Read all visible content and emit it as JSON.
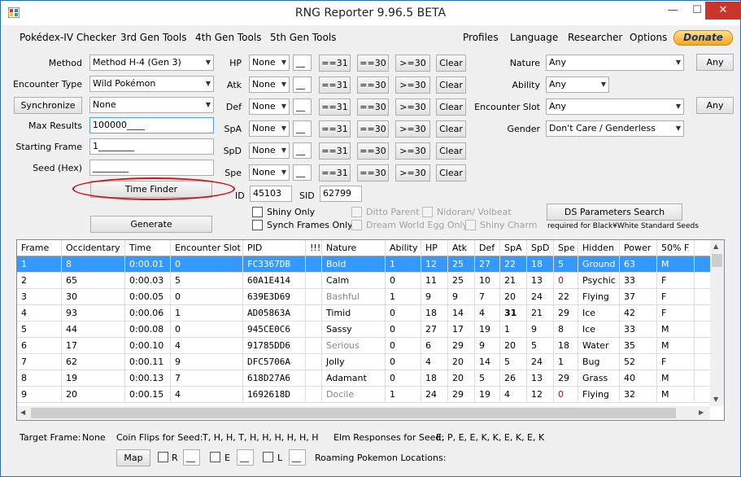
{
  "window": {
    "title": "RNG Reporter 9.96.5 BETA",
    "min": "—",
    "max": "☐",
    "close": "✕"
  },
  "menu": {
    "left": [
      "Pokédex-IV Checker",
      "3rd Gen Tools",
      "4th Gen Tools",
      "5th Gen Tools"
    ],
    "right": [
      "Profiles",
      "Language",
      "Researcher",
      "Options"
    ],
    "donate": "Donate"
  },
  "form": {
    "method_label": "Method",
    "method_value": "Method H-4 (Gen 3)",
    "encounter_label": "Encounter Type",
    "encounter_value": "Wild Pokémon",
    "sync_button": "Synchronize",
    "sync_value": "None",
    "max_label": "Max Results",
    "max_value": "100000____",
    "start_label": "Starting Frame",
    "start_value": "1________",
    "seed_label": "Seed (Hex)",
    "seed_value": "________",
    "time_finder": "Time Finder",
    "generate": "Generate"
  },
  "stats": {
    "rows": [
      {
        "label": "HP"
      },
      {
        "label": "Atk"
      },
      {
        "label": "Def"
      },
      {
        "label": "SpA"
      },
      {
        "label": "SpD"
      },
      {
        "label": "Spe"
      }
    ],
    "combo_value": "None",
    "box_value": "__",
    "b31": "==31",
    "b30": "==30",
    "bge30": ">=30",
    "clear": "Clear"
  },
  "ids": {
    "id_label": "ID",
    "id_value": "45103",
    "sid_label": "SID",
    "sid_value": "62799"
  },
  "checks": {
    "shiny": "Shiny Only",
    "synch": "Synch Frames Only",
    "ditto": "Ditto Parent",
    "nidoran": "Nidoran/ Volbeat",
    "dream": "Dream World Egg Only",
    "charm": "Shiny Charm"
  },
  "right": {
    "nature_label": "Nature",
    "nature_value": "Any",
    "ability_label": "Ability",
    "ability_value": "Any",
    "slot_label": "Encounter Slot",
    "slot_value": "Any",
    "gender_label": "Gender",
    "gender_value": "Don't Care /  Genderless",
    "any_button": "Any",
    "ds_button": "DS Parameters Search",
    "ds_note": "required for Black¥White Standard Seeds"
  },
  "table": {
    "headers": [
      "Frame",
      "Occidentary",
      "Time",
      "Encounter Slot",
      "PID",
      "!!!",
      "Nature",
      "Ability",
      "HP",
      "Atk",
      "Def",
      "SpA",
      "SpD",
      "Spe",
      "Hidden",
      "Power",
      "50% F"
    ],
    "rows": [
      [
        "1",
        "8",
        "0:00.01",
        "0",
        "FC3367DB",
        "",
        "Bold",
        "1",
        "12",
        "25",
        "27",
        "22",
        "18",
        "5",
        "Ground",
        "63",
        "M"
      ],
      [
        "2",
        "65",
        "0:00.03",
        "5",
        "60A1E414",
        "",
        "Calm",
        "0",
        "11",
        "25",
        "10",
        "21",
        "13",
        "0",
        "Psychic",
        "33",
        "F"
      ],
      [
        "3",
        "30",
        "0:00.05",
        "0",
        "639E3D69",
        "",
        "Bashful",
        "1",
        "9",
        "9",
        "7",
        "20",
        "24",
        "22",
        "Flying",
        "37",
        "F"
      ],
      [
        "4",
        "93",
        "0:00.06",
        "1",
        "AD05863A",
        "",
        "Timid",
        "0",
        "18",
        "14",
        "4",
        "31",
        "21",
        "29",
        "Ice",
        "42",
        "F"
      ],
      [
        "5",
        "44",
        "0:00.08",
        "0",
        "945CE0C6",
        "",
        "Sassy",
        "0",
        "27",
        "17",
        "19",
        "1",
        "9",
        "8",
        "Ice",
        "33",
        "M"
      ],
      [
        "6",
        "17",
        "0:00.10",
        "4",
        "91785DD6",
        "",
        "Serious",
        "0",
        "6",
        "29",
        "9",
        "20",
        "5",
        "18",
        "Water",
        "35",
        "M"
      ],
      [
        "7",
        "62",
        "0:00.11",
        "9",
        "DFC5706A",
        "",
        "Jolly",
        "0",
        "4",
        "20",
        "14",
        "5",
        "24",
        "1",
        "Bug",
        "52",
        "F"
      ],
      [
        "8",
        "19",
        "0:00.13",
        "7",
        "618D27A6",
        "",
        "Adamant",
        "0",
        "18",
        "20",
        "5",
        "26",
        "13",
        "29",
        "Grass",
        "40",
        "M"
      ],
      [
        "9",
        "20",
        "0:00.15",
        "4",
        "1692618D",
        "",
        "Docile",
        "1",
        "24",
        "29",
        "19",
        "4",
        "12",
        "0",
        "Flying",
        "32",
        "M"
      ]
    ]
  },
  "bottom": {
    "target_label": "Target Frame:",
    "target_value": "None",
    "coin_label": "Coin Flips for Seed:",
    "coin_value": "T, H, H, T, H, H, H, H, H, H",
    "elm_label": "Elm Responses for Seed:",
    "elm_value": "E, P, E, E, K, K, E, K, E, K",
    "map_button": "Map",
    "r": "R",
    "e": "E",
    "l": "L",
    "box": "__",
    "roaming": "Roaming Pokemon Locations:"
  },
  "colors": {
    "selection": "#3399ff",
    "accent": "#d31010"
  }
}
